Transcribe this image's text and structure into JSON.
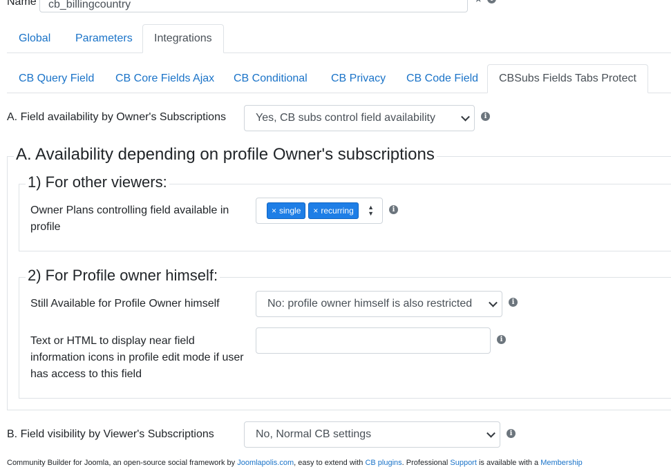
{
  "name_field": {
    "label": "Name",
    "value": "cb_billingcountry"
  },
  "main_tabs": [
    {
      "label": "Global"
    },
    {
      "label": "Parameters"
    },
    {
      "label": "Integrations"
    }
  ],
  "sub_tabs": [
    {
      "label": "CB Query Field"
    },
    {
      "label": "CB Core Fields Ajax"
    },
    {
      "label": "CB Conditional"
    },
    {
      "label": "CB Privacy"
    },
    {
      "label": "CB Code Field"
    },
    {
      "label": "CBSubs Fields Tabs Protect"
    }
  ],
  "field_availability": {
    "label": "A. Field availability by Owner's Subscriptions",
    "value": "Yes, CB subs control field availability"
  },
  "section_a": {
    "title": "A. Availability depending on profile Owner's subscriptions",
    "other_viewers": {
      "title": "1) For other viewers:",
      "plans_label_line1": "Owner Plans controlling field available in",
      "plans_label_line2": "profile",
      "tags": [
        "single",
        "recurring"
      ]
    },
    "profile_owner": {
      "title": "2) For Profile owner himself:",
      "still_available_label": "Still Available for Profile Owner himself",
      "still_available_value": "No: profile owner himself is also restricted",
      "text_html_label_line1": "Text or HTML to display near field",
      "text_html_label_line2": "information icons in profile edit mode if user",
      "text_html_label_line3": "has access to this field",
      "text_html_value": ""
    }
  },
  "field_visibility": {
    "label": "B. Field visibility by Viewer's Subscriptions",
    "value": "No, Normal CB settings"
  },
  "footer": {
    "text1": "Community Builder for Joomla, an open-source social framework by ",
    "link1": "Joomlapolis.com",
    "text2": ", easy to extend with ",
    "link2": "CB plugins",
    "text3": ". Professional ",
    "link3": "Support",
    "text4": " is available with a ",
    "link4": "Membership"
  },
  "colors": {
    "link": "#1a73c8",
    "tag_bg": "#1e7ee6",
    "border": "#dee2e6"
  }
}
